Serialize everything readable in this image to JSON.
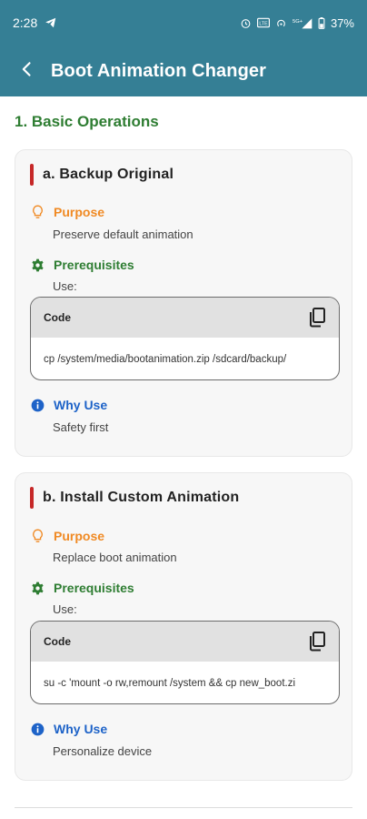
{
  "status_bar": {
    "time": "2:28",
    "battery": "37%",
    "network": "5G+"
  },
  "app_bar": {
    "title": "Boot Animation Changer"
  },
  "section": {
    "title": "1. Basic Operations"
  },
  "cards": [
    {
      "title": "a. Backup Original",
      "purpose_label": "Purpose",
      "purpose_text": "Preserve default animation",
      "prereq_label": "Prerequisites",
      "prereq_text": "Use:",
      "code_label": "Code",
      "code": "cp /system/media/bootanimation.zip /sdcard/backup/",
      "why_label": "Why Use",
      "why_text": "Safety first"
    },
    {
      "title": "b. Install Custom Animation",
      "purpose_label": "Purpose",
      "purpose_text": "Replace boot animation",
      "prereq_label": "Prerequisites",
      "prereq_text": "Use:",
      "code_label": "Code",
      "code": "su -c 'mount -o rw,remount /system && cp new_boot.zi",
      "why_label": "Why Use",
      "why_text": "Personalize device"
    }
  ],
  "colors": {
    "app_bar": "#357f95",
    "section_title": "#2e7d32",
    "purpose": "#f08a24",
    "prereq": "#2e7d32",
    "why": "#1e63c8",
    "title_accent": "#c62828"
  },
  "icons": {
    "back": "arrow-left-icon",
    "purpose": "lightbulb-icon",
    "prereq": "gear-icon",
    "why": "info-icon",
    "copy": "copy-icon"
  }
}
